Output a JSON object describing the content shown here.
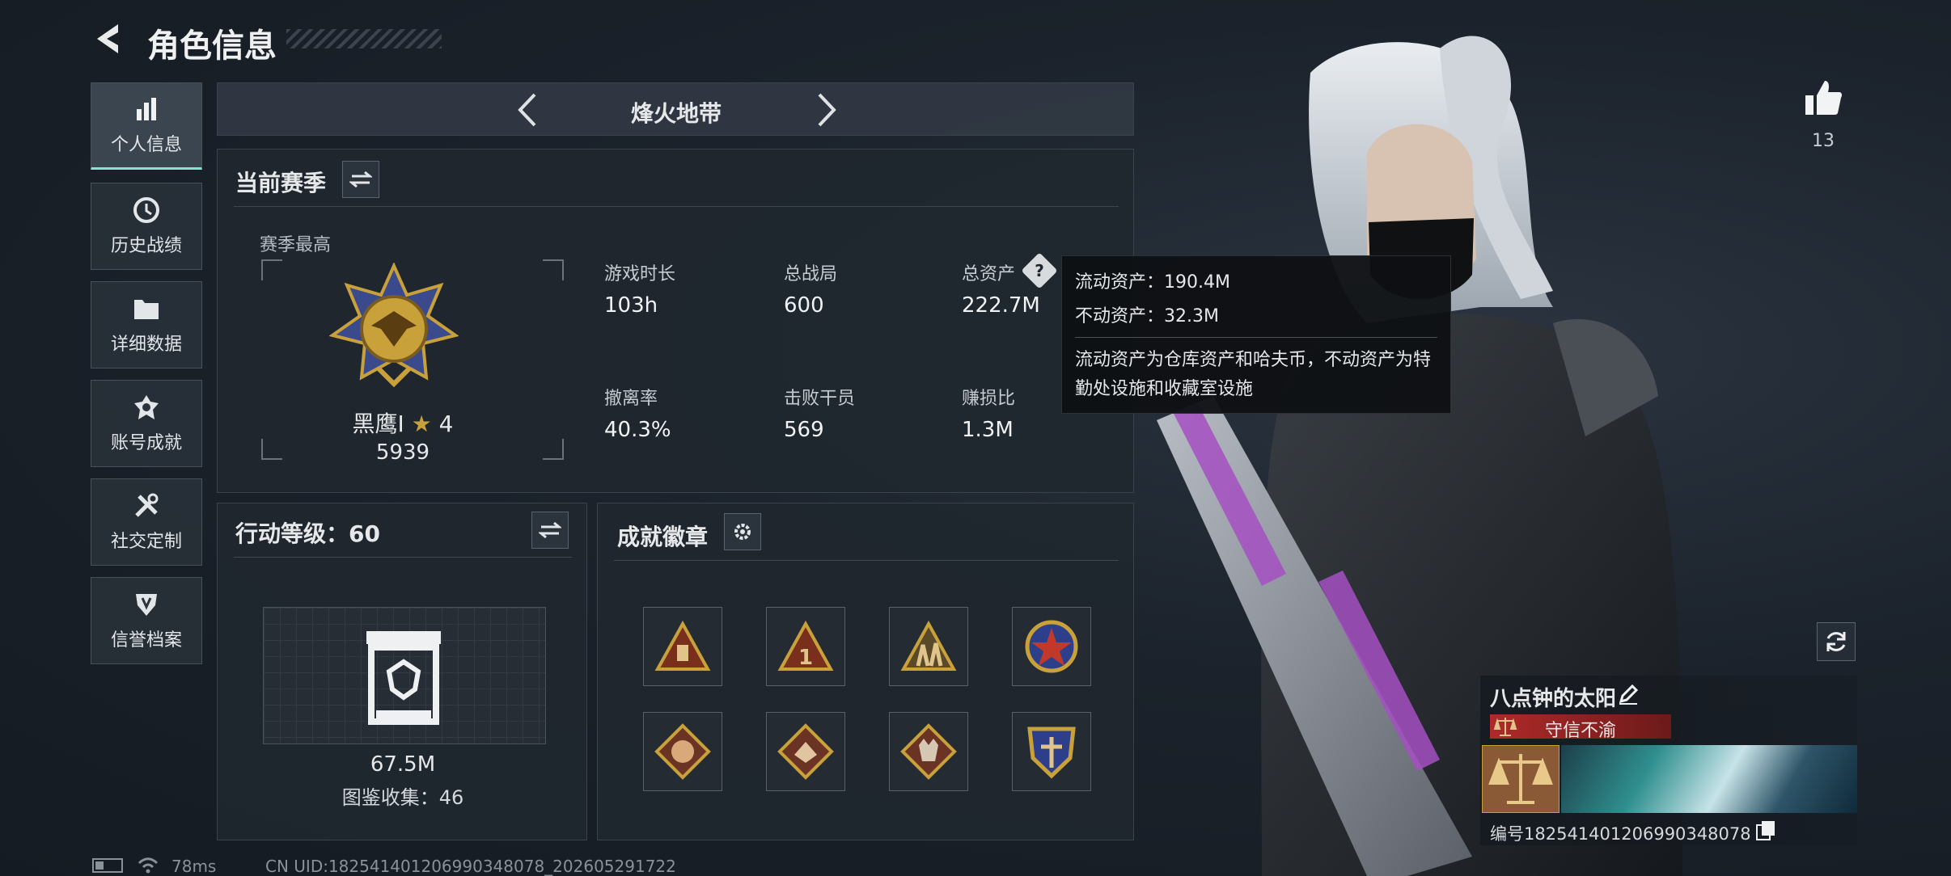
{
  "header": {
    "title": "角色信息"
  },
  "sidebar": {
    "items": [
      {
        "label": "个人信息",
        "icon": "bar-chart-icon"
      },
      {
        "label": "历史战绩",
        "icon": "history-icon"
      },
      {
        "label": "详细数据",
        "icon": "folder-icon"
      },
      {
        "label": "账号成就",
        "icon": "achievement-icon"
      },
      {
        "label": "社交定制",
        "icon": "tools-icon"
      },
      {
        "label": "信誉档案",
        "icon": "shield-icon"
      }
    ]
  },
  "mode": {
    "title": "烽火地带"
  },
  "season": {
    "title": "当前赛季",
    "best_label": "赛季最高",
    "rank_name": "黑鹰I",
    "rank_stars": "4",
    "rank_score": "5939",
    "stats": [
      {
        "label": "游戏时长",
        "value": "103h"
      },
      {
        "label": "总战局",
        "value": "600"
      },
      {
        "label": "总资产",
        "value": "222.7M"
      },
      {
        "label": "撤离率",
        "value": "40.3%"
      },
      {
        "label": "击败干员",
        "value": "569"
      },
      {
        "label": "赚损比",
        "value": "1.3M"
      }
    ]
  },
  "tooltip": {
    "line1": "流动资产：190.4M",
    "line2": "不动资产：32.3M",
    "desc": "流动资产为仓库资产和哈夫币，不动资产为特勤处设施和收藏室设施"
  },
  "action_level": {
    "title": "行动等级：60",
    "value": "67.5M",
    "collection": "图鉴收集：46"
  },
  "achievements": {
    "title": "成就徽章"
  },
  "likes": {
    "count": "13"
  },
  "player": {
    "name": "八点钟的太阳",
    "reputation": "守信不渝",
    "id_text": "编号182541401206990348078"
  },
  "status": {
    "ping": "78ms",
    "uid": "CN UID:182541401206990348078_202605291722"
  },
  "colors": {
    "accent": "#7de8d2",
    "reputation_red": "#8a1e1e",
    "gold": "#c9a13b"
  }
}
